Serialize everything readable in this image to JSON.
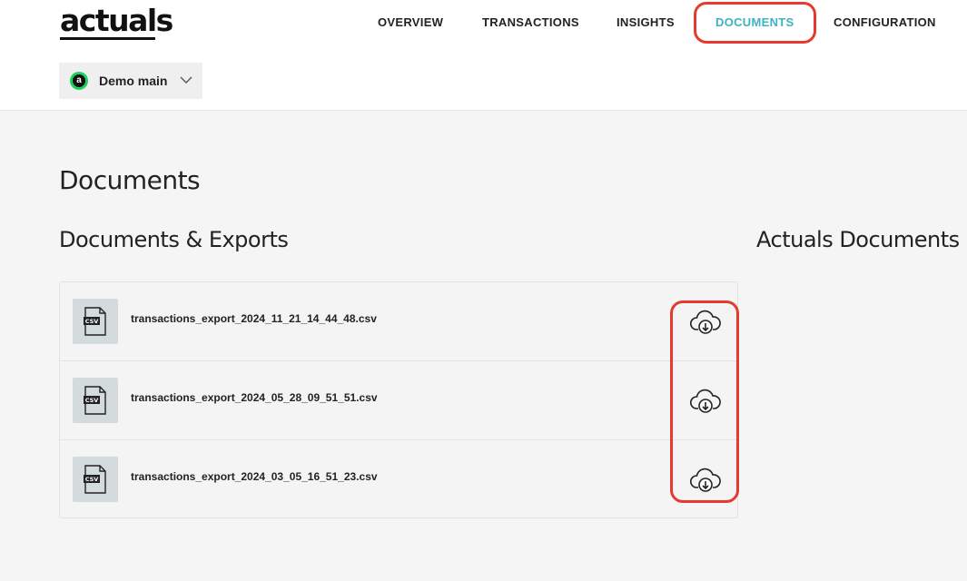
{
  "header": {
    "logo_text": "actuals",
    "nav": [
      {
        "label": "OVERVIEW"
      },
      {
        "label": "TRANSACTIONS"
      },
      {
        "label": "INSIGHTS"
      },
      {
        "label": "DOCUMENTS",
        "active": true
      },
      {
        "label": "CONFIGURATION"
      }
    ],
    "account": {
      "name": "Demo main",
      "logo_letter": "a",
      "logo_color": "#1bd25f"
    }
  },
  "page": {
    "title": "Documents",
    "left_section_title": "Documents & Exports",
    "right_section_title": "Actuals Documents"
  },
  "documents": [
    {
      "file_type": "CSV",
      "filename": "transactions_export_2024_11_21_14_44_48.csv",
      "action_icon": "cloud-download-icon"
    },
    {
      "file_type": "CSV",
      "filename": "transactions_export_2024_05_28_09_51_51.csv",
      "action_icon": "cloud-download-icon"
    },
    {
      "file_type": "CSV",
      "filename": "transactions_export_2024_03_05_16_51_23.csv",
      "action_icon": "cloud-download-icon"
    }
  ],
  "colors": {
    "accent": "#3db3c2",
    "highlight": "#e53a2e",
    "page_bg": "#f5f5f5",
    "file_icon_bg": "#d3dbdc"
  }
}
